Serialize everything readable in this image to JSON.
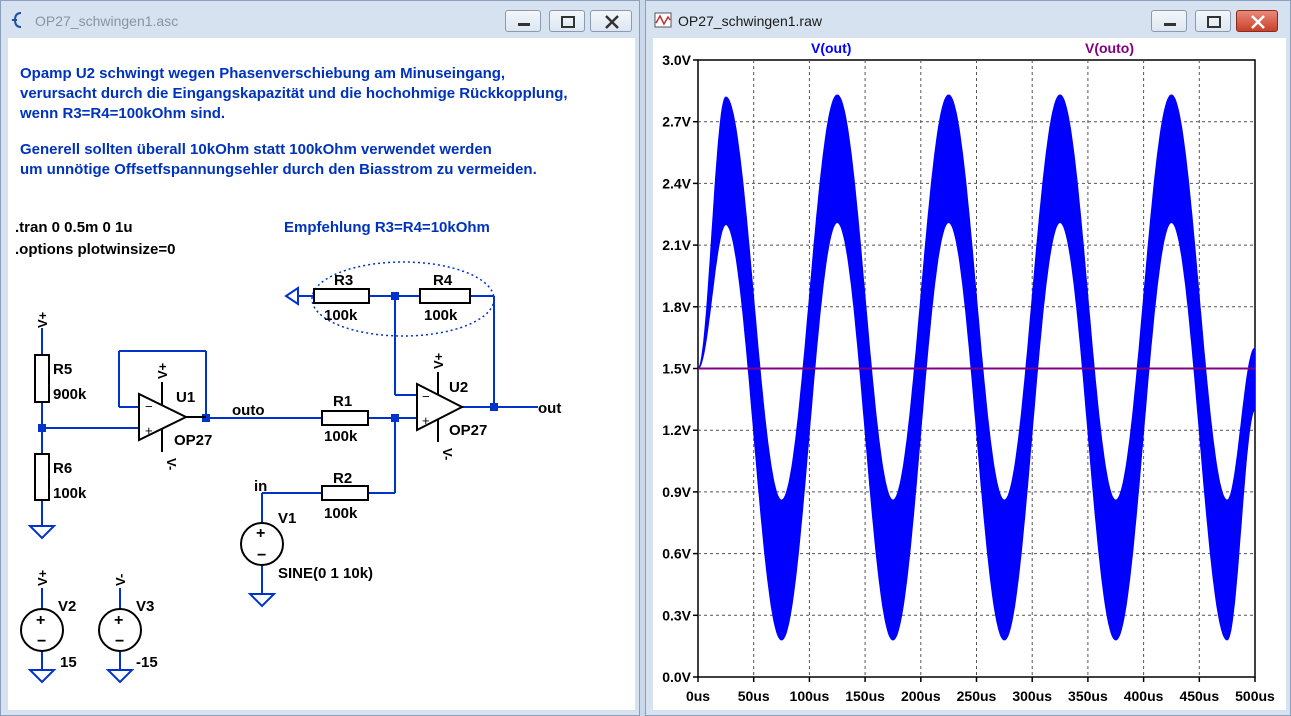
{
  "schematic_window": {
    "title": "OP27_schwingen1.asc",
    "comment_lines": [
      "Opamp U2 schwingt wegen Phasenverschiebung am Minuseingang,",
      "verursacht durch die Eingangskapazität und die hochohmige Rückkopplung,",
      "wenn R3=R4=100kOhm sind.",
      "Generell sollten überall 10kOhm statt 100kOhm verwendet werden",
      "um unnötige Offsetfspannungsehler durch den Biasstrom zu vermeiden."
    ],
    "directives": [
      ".tran 0 0.5m 0 1u",
      ".options plotwinsize=0"
    ],
    "recommendation": "Empfehlung R3=R4=10kOhm",
    "components": {
      "R3": {
        "name": "R3",
        "value": "100k"
      },
      "R4": {
        "name": "R4",
        "value": "100k"
      },
      "R5": {
        "name": "R5",
        "value": "900k"
      },
      "R6": {
        "name": "R6",
        "value": "100k"
      },
      "R1": {
        "name": "R1",
        "value": "100k"
      },
      "R2": {
        "name": "R2",
        "value": "100k"
      },
      "U1": {
        "name": "U1",
        "model": "OP27"
      },
      "U2": {
        "name": "U2",
        "model": "OP27"
      },
      "V1": {
        "name": "V1",
        "value": "SINE(0 1 10k)"
      },
      "V2": {
        "name": "V2",
        "value": "15"
      },
      "V3": {
        "name": "V3",
        "value": "-15"
      }
    },
    "nets": {
      "outo": "outo",
      "out": "out",
      "in": "in",
      "vplus": "V+",
      "vminus": "V-"
    },
    "colors": {
      "text": "#0033bb",
      "wire": "#0033cc",
      "component": "#000000",
      "background": "#ffffff"
    }
  },
  "waveform_window": {
    "title": "OP27_schwingen1.raw",
    "chart_data": {
      "type": "line",
      "xlabel": "",
      "ylabel": "",
      "xlim": [
        0,
        500
      ],
      "ylim": [
        0,
        3.0
      ],
      "x_unit": "us",
      "y_unit": "V",
      "x_ticks": [
        "0us",
        "50us",
        "100us",
        "150us",
        "200us",
        "250us",
        "300us",
        "350us",
        "400us",
        "450us",
        "500us"
      ],
      "y_ticks": [
        "0.0V",
        "0.3V",
        "0.6V",
        "0.9V",
        "1.2V",
        "1.5V",
        "1.8V",
        "2.1V",
        "2.4V",
        "2.7V",
        "3.0V"
      ],
      "grid": true,
      "series": [
        {
          "name": "V(out)",
          "color": "#0000ff",
          "description_type": "sine with high-frequency oscillation envelope",
          "x": [
            0,
            25,
            75,
            125,
            175,
            225,
            275,
            325,
            375,
            425,
            475,
            500
          ],
          "envelope_upper": [
            1.5,
            2.82,
            0.86,
            2.83,
            0.86,
            2.83,
            0.86,
            2.83,
            0.86,
            2.83,
            0.86,
            1.6
          ],
          "envelope_lower": [
            1.5,
            2.2,
            0.18,
            2.21,
            0.18,
            2.21,
            0.18,
            2.21,
            0.18,
            2.21,
            0.18,
            1.3
          ]
        },
        {
          "name": "V(outo)",
          "color": "#800080",
          "x": [
            0,
            500
          ],
          "y": [
            1.5,
            1.5
          ]
        }
      ]
    }
  }
}
